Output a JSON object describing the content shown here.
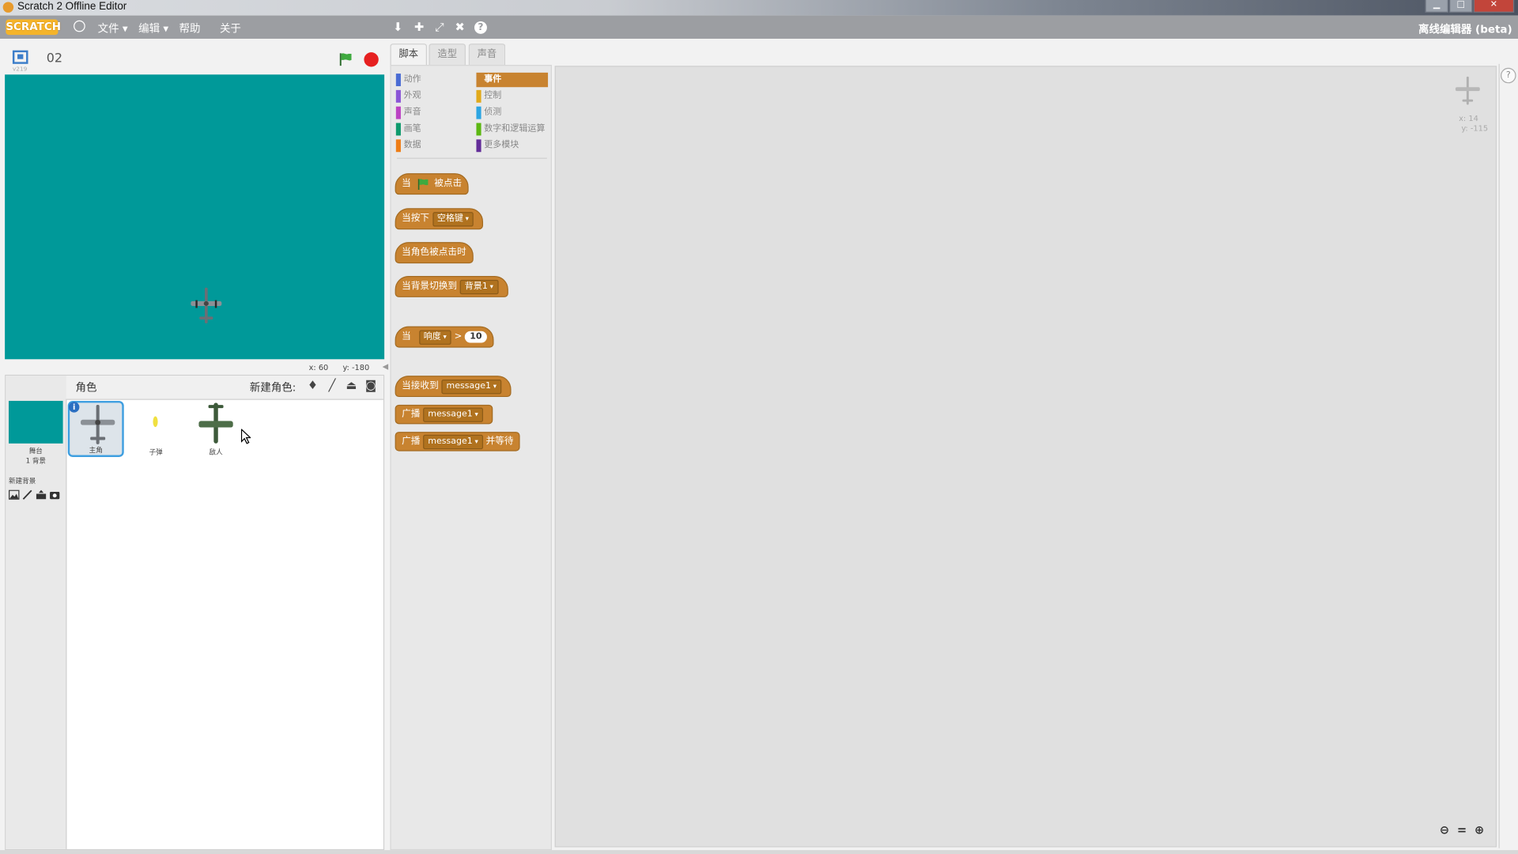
{
  "window": {
    "title": "Scratch 2 Offline Editor",
    "controls": [
      "minimize",
      "maximize",
      "close"
    ]
  },
  "menubar": {
    "logo": "SCRATCH",
    "items": [
      {
        "label": "文件",
        "dropdown": true
      },
      {
        "label": "编辑",
        "dropdown": true
      },
      {
        "label": "帮助",
        "dropdown": false
      },
      {
        "label": "关于",
        "dropdown": false
      }
    ],
    "tools": [
      "duplicate-icon",
      "cut-icon",
      "grow-icon",
      "shrink-icon",
      "help-icon"
    ],
    "right_label": "离线编辑器 (beta)"
  },
  "stage": {
    "project_title": "02",
    "version": "v219",
    "background_color": "#009999",
    "mouse_x_label": "x: 60",
    "mouse_y_label": "y: -180"
  },
  "sprite_pane": {
    "sprites_label": "角色",
    "new_sprite_label": "新建角色:",
    "stage_label": "舞台",
    "stage_backdrops": "1 背景",
    "new_backdrop_label": "新建背景",
    "sprites": [
      {
        "name": "主角",
        "selected": true
      },
      {
        "name": "子弹",
        "selected": false
      },
      {
        "name": "敌人",
        "selected": false
      }
    ]
  },
  "tabs": [
    {
      "label": "脚本",
      "active": true
    },
    {
      "label": "造型",
      "active": false
    },
    {
      "label": "声音",
      "active": false
    }
  ],
  "palette": {
    "categories_left": [
      {
        "label": "动作",
        "color": "#4a6cd4"
      },
      {
        "label": "外观",
        "color": "#8a55d7"
      },
      {
        "label": "声音",
        "color": "#bb42c3"
      },
      {
        "label": "画笔",
        "color": "#0e9a6c"
      },
      {
        "label": "数据",
        "color": "#ee7d16"
      }
    ],
    "categories_right": [
      {
        "label": "事件",
        "color": "#c88330",
        "active": true
      },
      {
        "label": "控制",
        "color": "#e1a91a",
        "active": false
      },
      {
        "label": "侦测",
        "color": "#2ca5e2",
        "active": false
      },
      {
        "label": "数字和逻辑运算",
        "color": "#5cb712",
        "active": false
      },
      {
        "label": "更多模块",
        "color": "#632d99",
        "active": false
      }
    ],
    "blocks": {
      "when_flag_prefix": "当",
      "when_flag_suffix": "被点击",
      "when_key_prefix": "当按下",
      "when_key_value": "空格键",
      "when_sprite_clicked": "当角色被点击时",
      "when_backdrop_prefix": "当背景切换到",
      "when_backdrop_value": "背景1",
      "when_sensor_prefix": "当",
      "when_sensor_value": "响度",
      "when_sensor_op": ">",
      "when_sensor_num": "10",
      "when_receive_prefix": "当接收到",
      "when_receive_value": "message1",
      "broadcast_prefix": "广播",
      "broadcast_value": "message1",
      "broadcast_wait_prefix": "广播",
      "broadcast_wait_value": "message1",
      "broadcast_wait_suffix": "并等待"
    }
  },
  "script_area": {
    "sprite_x": "x: 14",
    "sprite_y": "y: -115",
    "zoom": [
      "zoom-out-icon",
      "zoom-reset-icon",
      "zoom-in-icon"
    ]
  }
}
